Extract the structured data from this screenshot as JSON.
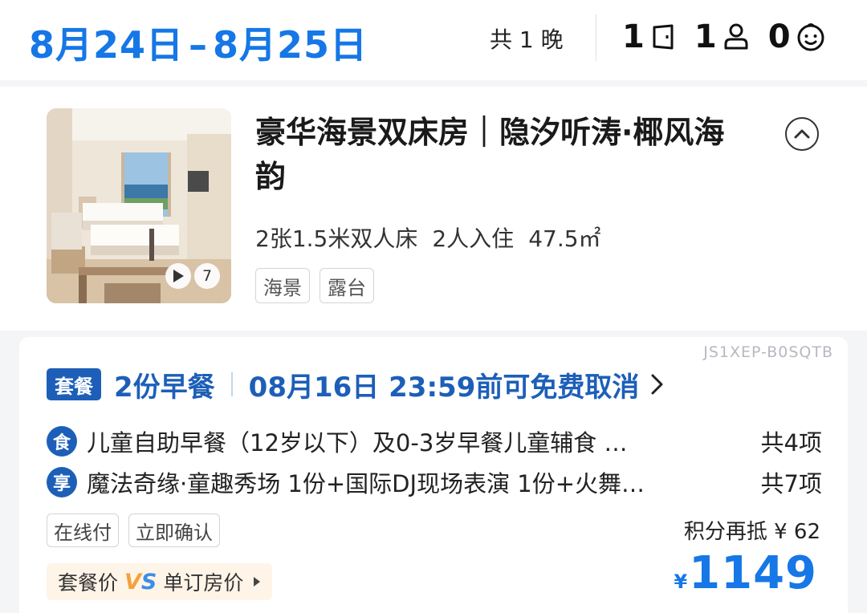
{
  "header": {
    "check_in": "8月24日",
    "separator": "–",
    "check_out": "8月25日",
    "nights": "共 1 晚",
    "rooms": "1",
    "adults": "1",
    "children": "0"
  },
  "room": {
    "title": "豪华海景双床房｜隐汐听涛·椰风海韵",
    "beds": "2张1.5米双人床",
    "occupancy": "2人入住",
    "area": "47.5㎡",
    "photo_count": "7",
    "tags": [
      "海景",
      "露台"
    ]
  },
  "package": {
    "code": "JS1XEP-B0SQTB",
    "badge": "套餐",
    "breakfast": "2份早餐",
    "cancel_policy": "08月16日 23:59前可免费取消",
    "items": [
      {
        "icon_label": "食",
        "text": "儿童自助早餐（12岁以下）及0-3岁早餐儿童辅食 …",
        "count": "共4项"
      },
      {
        "icon_label": "享",
        "text": "魔法奇缘·童趣秀场 1份+国际DJ现场表演 1份+火舞…",
        "count": "共7项"
      }
    ],
    "pay_tags": [
      "在线付",
      "立即确认"
    ],
    "points_text": "积分再抵 ¥ 62",
    "compare_left": "套餐价",
    "compare_vs": "VS",
    "compare_right": "单订房价",
    "price_currency": "¥",
    "price": "1149"
  },
  "colors": {
    "accent": "#1677e6",
    "badge": "#1d5fb8",
    "compare_bg": "#fff4e8"
  },
  "icons": [
    "room-door-icon",
    "adult-icon",
    "child-icon",
    "play-icon",
    "collapse-chevron-icon",
    "chevron-right-icon",
    "triangle-right-icon"
  ]
}
